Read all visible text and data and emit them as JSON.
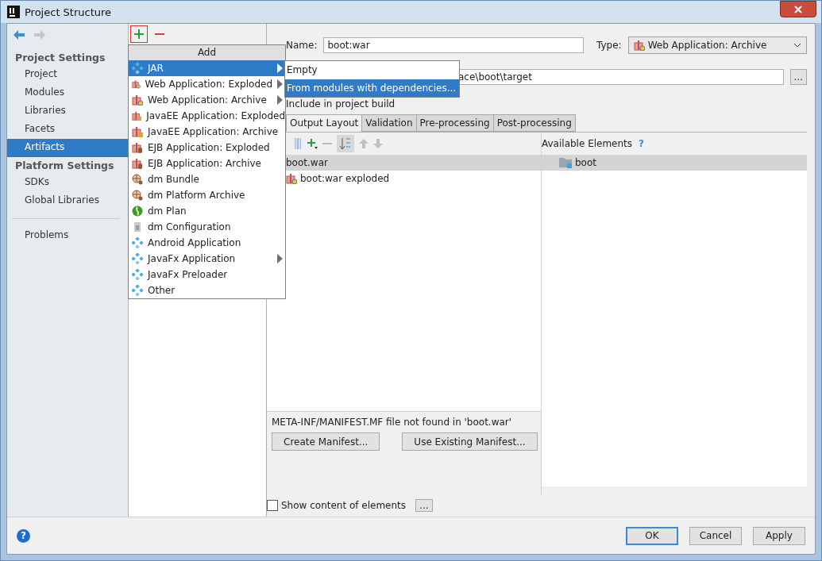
{
  "window": {
    "title": "Project Structure"
  },
  "sidebar": {
    "sections": [
      {
        "title": "Project Settings",
        "items": [
          {
            "label": "Project",
            "selected": false
          },
          {
            "label": "Modules",
            "selected": false
          },
          {
            "label": "Libraries",
            "selected": false
          },
          {
            "label": "Facets",
            "selected": false
          },
          {
            "label": "Artifacts",
            "selected": true
          }
        ]
      },
      {
        "title": "Platform Settings",
        "items": [
          {
            "label": "SDKs",
            "selected": false
          },
          {
            "label": "Global Libraries",
            "selected": false
          }
        ]
      },
      {
        "items": [
          {
            "label": "Problems",
            "selected": false
          }
        ]
      }
    ]
  },
  "add_menu": {
    "title": "Add",
    "items": [
      {
        "label": "JAR",
        "kind": "jar",
        "submenu": true,
        "selected": true
      },
      {
        "label": "Web Application: Exploded",
        "kind": "web",
        "submenu": true,
        "selected": false
      },
      {
        "label": "Web Application: Archive",
        "kind": "web",
        "submenu": true,
        "selected": false
      },
      {
        "label": "JavaEE Application: Exploded",
        "kind": "javaee",
        "submenu": false,
        "selected": false
      },
      {
        "label": "JavaEE Application: Archive",
        "kind": "javaee",
        "submenu": false,
        "selected": false
      },
      {
        "label": "EJB Application: Exploded",
        "kind": "ejb",
        "submenu": false,
        "selected": false
      },
      {
        "label": "EJB Application: Archive",
        "kind": "ejb",
        "submenu": false,
        "selected": false
      },
      {
        "label": "dm Bundle",
        "kind": "bundle",
        "submenu": false,
        "selected": false
      },
      {
        "label": "dm Platform Archive",
        "kind": "bundle",
        "submenu": false,
        "selected": false
      },
      {
        "label": "dm Plan",
        "kind": "plan",
        "submenu": false,
        "selected": false
      },
      {
        "label": "dm Configuration",
        "kind": "config",
        "submenu": false,
        "selected": false
      },
      {
        "label": "Android Application",
        "kind": "jar",
        "submenu": false,
        "selected": false
      },
      {
        "label": "JavaFx Application",
        "kind": "jar",
        "submenu": true,
        "selected": false
      },
      {
        "label": "JavaFx Preloader",
        "kind": "jar",
        "submenu": false,
        "selected": false
      },
      {
        "label": "Other",
        "kind": "jar",
        "submenu": false,
        "selected": false
      }
    ]
  },
  "submenu": {
    "items": [
      {
        "label": "Empty",
        "selected": false
      },
      {
        "label": "From modules with dependencies...",
        "selected": true
      }
    ]
  },
  "artifact": {
    "name_label": "Name:",
    "name": "boot:war",
    "type_label": "Type:",
    "type": "Web Application: Archive",
    "output_directory": "ace\\boot\\target",
    "browse": "...",
    "include_label": "Include in project build"
  },
  "tabs": [
    {
      "label": "Output Layout",
      "selected": true
    },
    {
      "label": "Validation",
      "selected": false
    },
    {
      "label": "Pre-processing",
      "selected": false
    },
    {
      "label": "Post-processing",
      "selected": false
    }
  ],
  "layout_tree": {
    "items": [
      {
        "label": "boot.war",
        "selected": true,
        "children": [
          {
            "label": "boot:war exploded",
            "selected": false
          }
        ]
      }
    ]
  },
  "available": {
    "title": "Available Elements",
    "help": "?",
    "items": [
      {
        "label": "boot",
        "selected": true
      }
    ]
  },
  "manifest": {
    "message": "META-INF/MANIFEST.MF file not found in 'boot.war'",
    "buttons": [
      "Create Manifest...",
      "Use Existing Manifest..."
    ]
  },
  "show_content": {
    "label": "Show content of elements",
    "checked": false,
    "more": "..."
  },
  "footer": {
    "help": "?",
    "buttons": [
      {
        "label": "OK",
        "default": true
      },
      {
        "label": "Cancel",
        "default": false
      },
      {
        "label": "Apply",
        "default": false
      }
    ]
  }
}
